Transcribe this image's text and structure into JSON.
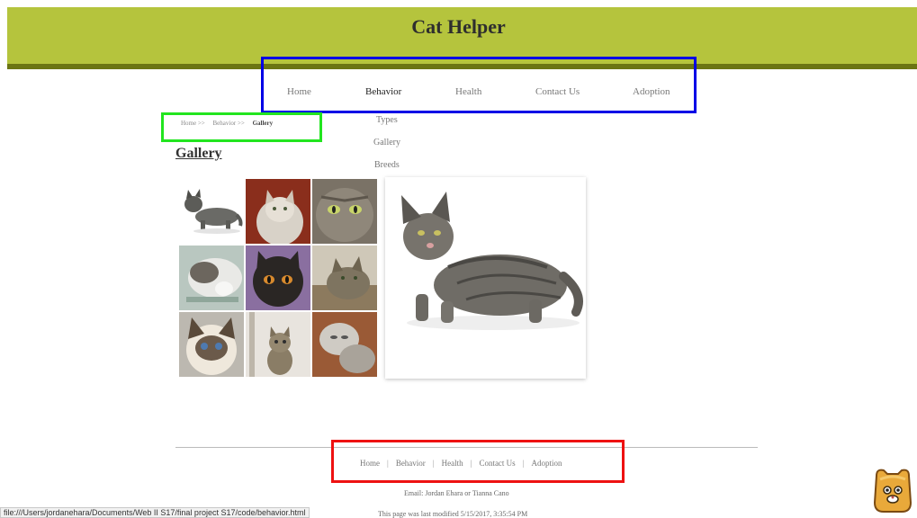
{
  "site": {
    "title": "Cat Helper"
  },
  "nav": {
    "items": [
      {
        "label": "Home"
      },
      {
        "label": "Behavior"
      },
      {
        "label": "Health"
      },
      {
        "label": "Contact Us"
      },
      {
        "label": "Adoption"
      }
    ],
    "dropdown": [
      {
        "label": "Types"
      },
      {
        "label": "Gallery"
      },
      {
        "label": "Breeds"
      }
    ]
  },
  "breadcrumb": {
    "items": [
      "Home >>",
      "Behavior >>",
      "Gallery"
    ]
  },
  "page": {
    "title": "Gallery"
  },
  "footer": {
    "links": [
      "Home",
      "Behavior",
      "Health",
      "Contact Us",
      "Adoption"
    ],
    "separator": "|",
    "email": "Email: Jordan Ehara or Tianna Cano",
    "modified": "This page was last modified 5/15/2017, 3:35:54 PM"
  },
  "status_bar": {
    "url": "file:///Users/jordanehara/Documents/Web II S17/final project S17/code/behavior.html"
  },
  "colors": {
    "header_green": "#b5c43d",
    "header_stripe": "#6b7513",
    "annotation_blue": "#0000e6",
    "annotation_green": "#22e51f",
    "annotation_red": "#ee1111"
  }
}
